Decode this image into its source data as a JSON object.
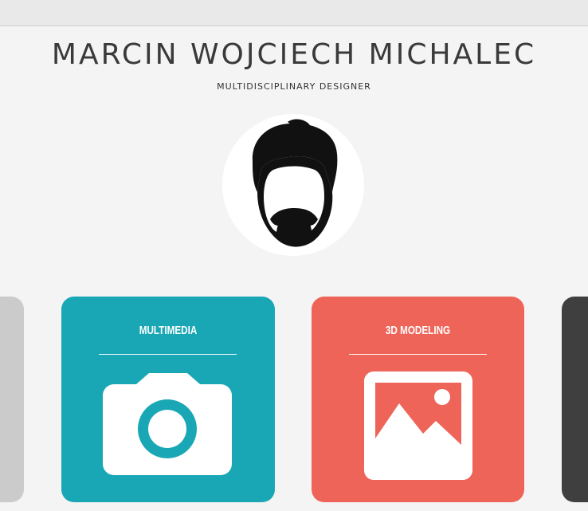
{
  "header": {
    "name": "MARCIN WOJCIECH MICHALEC",
    "tagline": "MULTIDISCIPLINARY DESIGNER"
  },
  "avatar": {
    "icon": "bearded-man-icon"
  },
  "cards": [
    {
      "label": "MULTIMEDIA",
      "icon": "camera-icon",
      "color": "#1aa7b5"
    },
    {
      "label": "3D MODELING",
      "icon": "image-icon",
      "color": "#ef6459"
    }
  ],
  "colors": {
    "background": "#f4f4f4",
    "left_card": "#cbcbcb",
    "right_card": "#3f3f3f"
  }
}
